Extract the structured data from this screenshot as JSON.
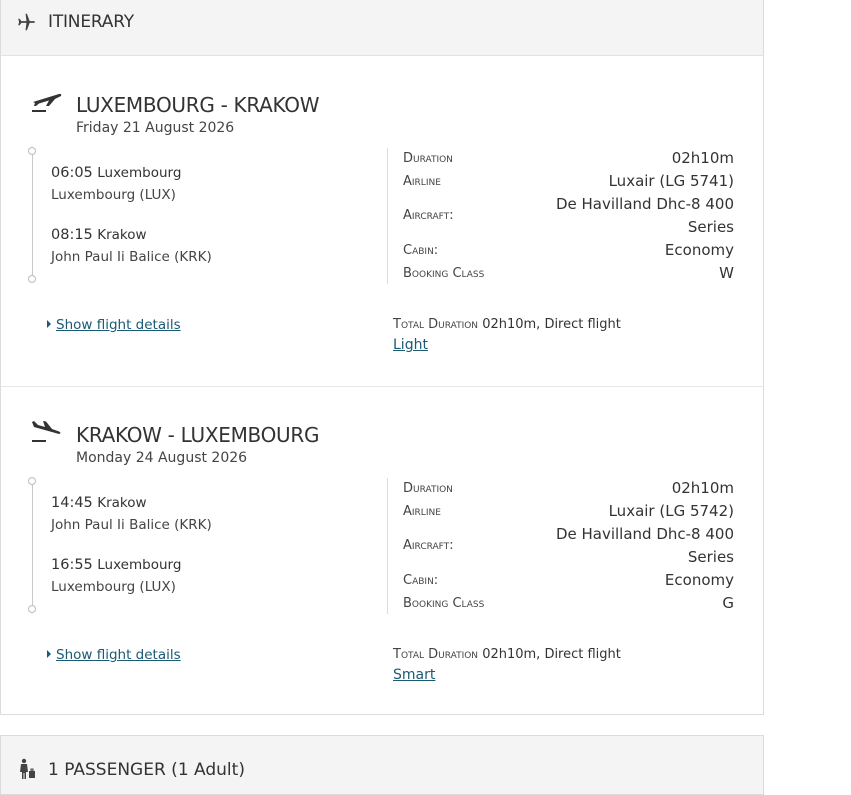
{
  "itinerary": {
    "title": "ITINERARY",
    "legs": [
      {
        "route": "LUXEMBOURG - KRAKOW",
        "date": "Friday 21 August 2026",
        "dep_time": "06:05",
        "dep_city": "Luxembourg",
        "dep_airport": "Luxembourg (LUX)",
        "arr_time": "08:15",
        "arr_city": "Krakow",
        "arr_airport": "John Paul Ii Balice (KRK)",
        "duration_label": "Duration",
        "duration": "02h10m",
        "airline_label": "Airline",
        "airline": "Luxair (LG 5741)",
        "aircraft_label": "Aircraft:",
        "aircraft_line1": "De Havilland Dhc-8 400",
        "aircraft_line2": "Series",
        "cabin_label": "Cabin:",
        "cabin": "Economy",
        "booking_class_label": "Booking Class",
        "booking_class": "W",
        "details_link": "Show flight details",
        "total_duration_label": "Total Duration",
        "total_duration": "02h10m, Direct flight",
        "fare": "Light "
      },
      {
        "route": "KRAKOW - LUXEMBOURG",
        "date": "Monday 24 August 2026",
        "dep_time": "14:45",
        "dep_city": "Krakow",
        "dep_airport": "John Paul Ii Balice (KRK)",
        "arr_time": "16:55",
        "arr_city": "Luxembourg",
        "arr_airport": "Luxembourg (LUX)",
        "duration_label": "Duration",
        "duration": "02h10m",
        "airline_label": "Airline",
        "airline": "Luxair (LG 5742)",
        "aircraft_label": "Aircraft:",
        "aircraft_line1": "De Havilland Dhc-8 400",
        "aircraft_line2": "Series",
        "cabin_label": "Cabin:",
        "cabin": "Economy",
        "booking_class_label": "Booking Class",
        "booking_class": "G",
        "details_link": "Show flight details",
        "total_duration_label": "Total Duration",
        "total_duration": "02h10m, Direct flight",
        "fare": "Smart "
      }
    ]
  },
  "passengers": {
    "title": "1 PASSENGER (1 Adult)"
  },
  "icons": {
    "header": "airplane-icon",
    "outbound": "plane-takeoff-icon",
    "inbound": "plane-landing-icon",
    "passengers": "passenger-luggage-icon"
  },
  "colors": {
    "link": "#1a5a73",
    "header_bg": "#f4f4f4",
    "text": "#333333"
  }
}
